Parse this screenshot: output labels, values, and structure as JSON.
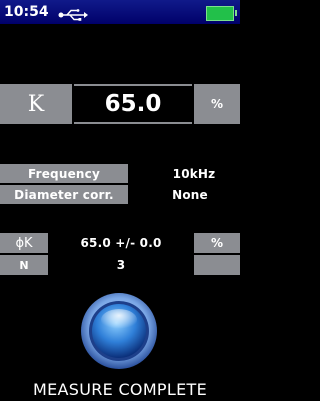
{
  "status_bar": {
    "time": "10:54",
    "usb_icon": "usb-icon",
    "battery_icon": "battery-icon",
    "battery_color": "#22c04a"
  },
  "main_reading": {
    "symbol": "K",
    "value": "65.0",
    "unit": "%"
  },
  "settings": {
    "frequency_label": "Frequency",
    "frequency_value": "10kHz",
    "diameter_label": "Diameter corr.",
    "diameter_value": "None"
  },
  "stats": {
    "phik_label": "ϕK",
    "phik_value": "65.0 +/- 0.0",
    "phik_unit": "%",
    "n_label": "N",
    "n_value": "3"
  },
  "measure_button_icon": "measure-button-icon",
  "status_message": "MEASURE COMPLETE",
  "colors": {
    "statusbar": "#00006a",
    "cell_grey": "#8b8d92",
    "background": "#000000"
  }
}
